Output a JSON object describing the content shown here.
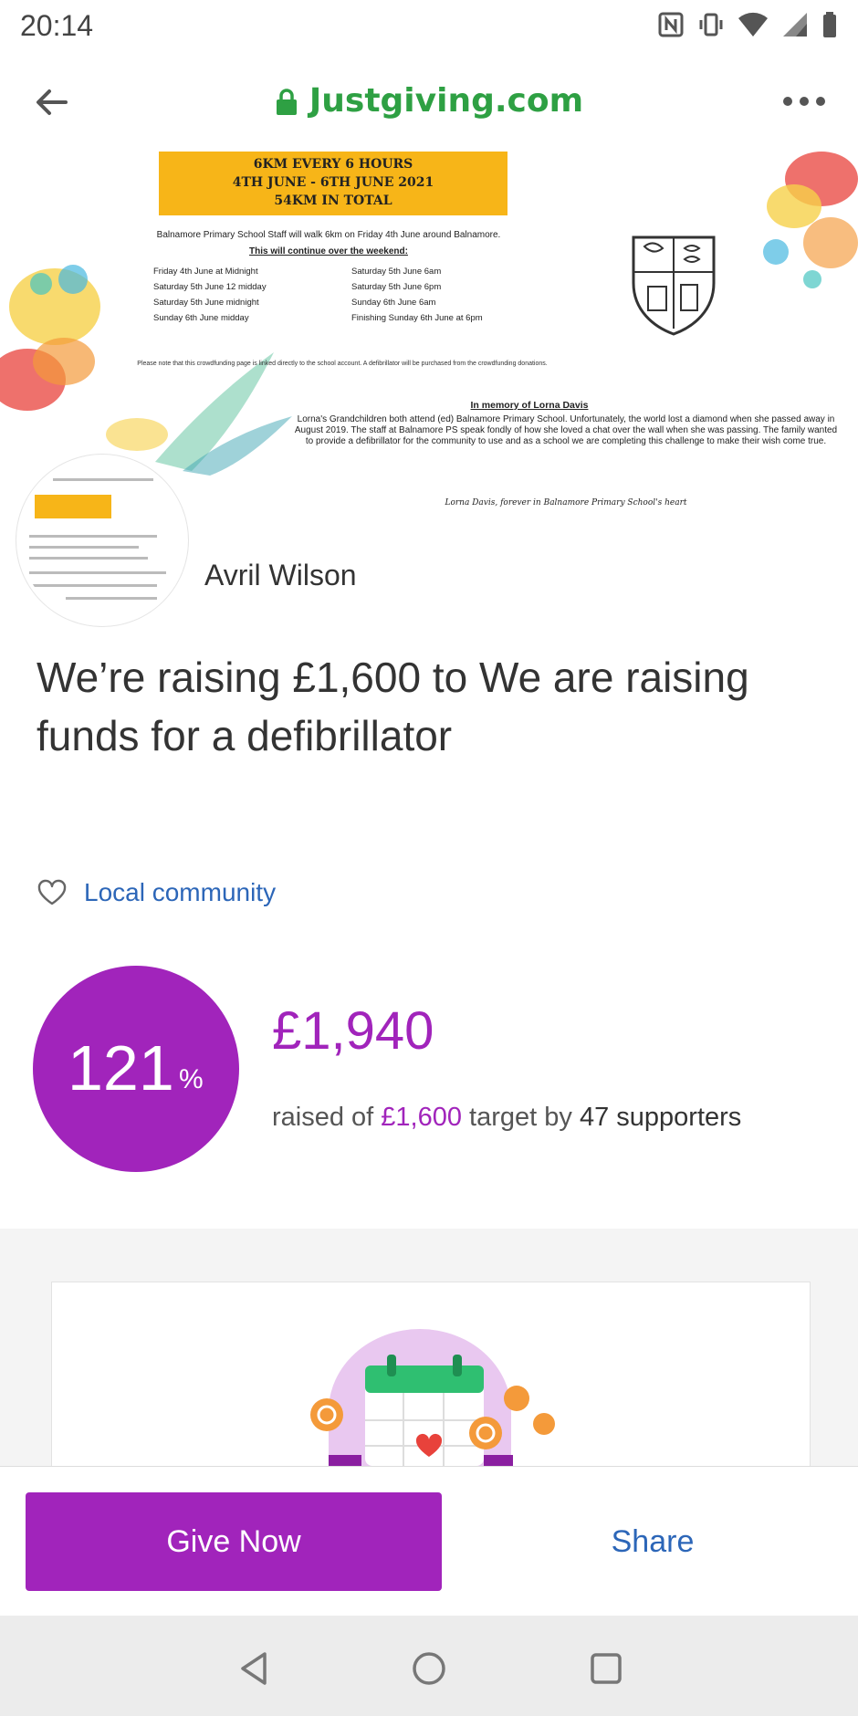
{
  "status_bar": {
    "time": "20:14"
  },
  "browser": {
    "domain": "Justgiving.com"
  },
  "poster": {
    "banner_line1": "6KM EVERY 6 HOURS",
    "banner_line2": "4TH JUNE - 6TH JUNE 2021",
    "banner_line3": "54KM IN TOTAL",
    "intro": "Balnamore Primary School Staff will walk 6km on Friday 4th June around Balnamore.",
    "subheading": "This will continue over the weekend:",
    "schedule": [
      "Friday 4th June at Midnight",
      "Saturday 5th June 6am",
      "Saturday 5th June 12 midday",
      "Saturday 5th June 6pm",
      "Saturday 5th June midnight",
      "Sunday 6th June 6am",
      "Sunday 6th June midday",
      "Finishing Sunday 6th June at 6pm"
    ],
    "note": "Please note that this crowdfunding page is linked directly to the school account. A defibrillator will be purchased from the crowdfunding donations.",
    "memory_title": "In memory of Lorna Davis",
    "memory_text": "Lorna's Grandchildren both attend (ed) Balnamore Primary School. Unfortunately, the world lost a diamond when she passed away in August 2019. The staff at Balnamore PS speak fondly of how she loved a chat over the wall when she was passing. The family wanted to provide a defibrillator for the community to use and as a school we are completing this challenge to make their wish come true.",
    "memory_sign": "Lorna Davis, forever in Balnamore Primary School's heart"
  },
  "organiser": {
    "name": "Avril Wilson"
  },
  "headline": "We’re raising £1,600 to We are raising funds for a defibrillator",
  "category": {
    "label": "Local community"
  },
  "progress": {
    "percent": "121",
    "percent_sign": "%",
    "raised": "£1,940",
    "raised_prefix": "raised of ",
    "target": "£1,600",
    "target_mid": " target by ",
    "supporters": "47 supporters"
  },
  "actions": {
    "give_label": "Give Now",
    "share_label": "Share"
  },
  "colors": {
    "brand": "#a124bb",
    "link": "#2c66b8",
    "domain": "#2ea043",
    "banner": "#f7b518"
  }
}
